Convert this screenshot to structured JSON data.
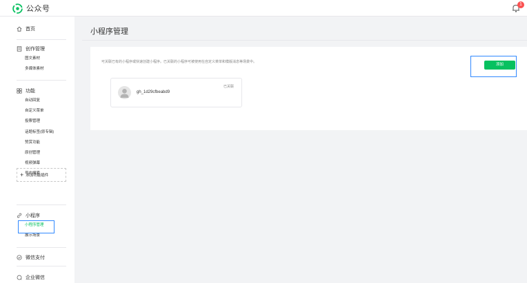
{
  "header": {
    "brand": "公众号",
    "notification_count": "1"
  },
  "sidebar": {
    "home": "首页",
    "creation": {
      "title": "创作管理",
      "items": [
        "图文素材",
        "多媒体素材"
      ]
    },
    "features": {
      "title": "功能",
      "items": [
        "自动回复",
        "自定义菜单",
        "投票管理",
        "话题标签(原专辑)",
        "赞赏功能",
        "原创管理",
        "视频弹幕",
        "号内搜索"
      ],
      "add_plugin": "添加功能插件"
    },
    "mini_program": {
      "title": "小程序",
      "items": [
        "小程序管理",
        "展示场景"
      ]
    },
    "wechat_pay": "微信支付",
    "wecom": "企业微信"
  },
  "main": {
    "title": "小程序管理",
    "description": "可关联已有的小程序或快速创建小程序。已关联的小程序可被使用在自定义菜单和模版消息等场景中。",
    "add_button": "添加",
    "linked_card": {
      "app_id": "gh_1d29cfbeabd9",
      "status": "已关联"
    }
  },
  "colors": {
    "brand_green": "#07c160",
    "highlight_blue": "#2f88ff",
    "badge_red": "#fa5151"
  }
}
